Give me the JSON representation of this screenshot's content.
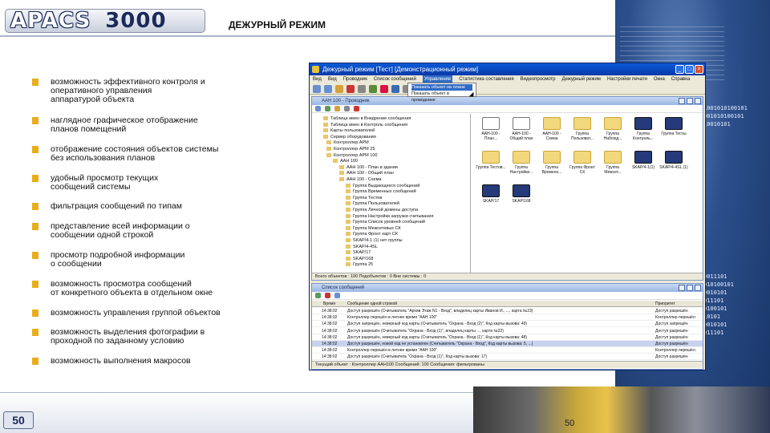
{
  "header": {
    "logo_main": "APACS",
    "logo_num": "3000",
    "title": "ДЕЖУРНЫЙ РЕЖИМ"
  },
  "bullets": [
    "возможность  эффективного контроля и\nоперативного управления\nаппаратурой объекта",
    "наглядное графическое отображение\nпланов помещений",
    "отображение состояния объектов системы\nбез использования планов",
    "удобный просмотр текущих\nсообщений системы",
    "фильтрация сообщений по типам",
    "представление всей информации о\nсообщении одной строкой",
    "просмотр подробной информации\nо сообщении",
    "возможность просмотра сообщений\nот конкретного объекта в отдельном окне",
    "возможность управления группой объектов",
    "возможность выделения фотографии в\nпроходной по заданному условию",
    "возможность выполнения макросов"
  ],
  "footer": {
    "page_box": "50",
    "page_small": "50"
  },
  "deco": {
    "binary_1": "1001010100101\n001010100101\n10010101",
    "binary_2": "0011101\n010100101\n0010101\n011101\n0100101\n10101\n0010101\n011101"
  },
  "app": {
    "window_title": "Дежурный режим [Тест] [Демонстрационный режим]",
    "menu": [
      "Вид",
      "Вид",
      "Проводник",
      "Список сообщений",
      "Управление",
      "Статистика составления",
      "Видеопросмотр",
      "Дежурный режим",
      "Настройки печати",
      "Окна",
      "Справка"
    ],
    "menu_active_index": 4,
    "dropdown": [
      "Показать объект на плане",
      "Показать объект в проводнике"
    ],
    "explorer_title": "ААН 100 - Проводник",
    "message_title": "Список сообщений",
    "tree": [
      "Таблица имен в Внедрение сообщения",
      "Таблица имен в Контроль сообщения",
      "Карты пользователей",
      "Сервер оборудования",
      "Контроллер АРМ",
      "Контроллер АРМ 25",
      "Контроллер АРМ 100",
      "ААН 100",
      "ААН 100 - План в здании",
      "ААН 100 - Общий план",
      "ААН 100 - Схема",
      "Группа Выдающихся сообщений",
      "Группа Временных сообщений",
      "Группа Тестов",
      "Группа Пользователей",
      "Группа Личной домены доступа",
      "Группа Настройки загрузки считывания",
      "Группа Список уровней сообщений",
      "Группа Межсетевых СК",
      "Группа Фронт карт СК",
      "SKAP/4-1 (1) нет группы",
      "SKAP/4-4SL",
      "SKAP/17",
      "SKAP/168",
      "Группа 25"
    ],
    "explorer_icons": [
      {
        "label": "ААН-100 - План...",
        "kind": "chart"
      },
      {
        "label": "ААН-100 - Общий план",
        "kind": "chart"
      },
      {
        "label": "ААН-100 - Схема",
        "kind": "folder"
      },
      {
        "label": "Группа Пользоват...",
        "kind": "folder"
      },
      {
        "label": "Группа Наблюд...",
        "kind": "folder"
      },
      {
        "label": "Группа Контроль...",
        "kind": "dev"
      },
      {
        "label": "Группа Тесты",
        "kind": "dev"
      },
      {
        "label": "Группа Тестов...",
        "kind": "folder"
      },
      {
        "label": "Группа Настройки...",
        "kind": "folder"
      },
      {
        "label": "Группа Временн...",
        "kind": "folder"
      },
      {
        "label": "Группа Фронт СК",
        "kind": "folder"
      },
      {
        "label": "Группа Межсет...",
        "kind": "folder"
      },
      {
        "label": "SKAP/4-1(1)",
        "kind": "dev"
      },
      {
        "label": "SKAP/4-4SL (1)",
        "kind": "dev"
      },
      {
        "label": "SKAP/17",
        "kind": "dev"
      },
      {
        "label": "SKAP/168",
        "kind": "dev"
      }
    ],
    "explorer_status": "Всего объектов : 100          Подобъектов : 0          Вне системы : 0",
    "messages_columns": [
      "Время",
      "Сообщение одной строкой",
      "Приоритет"
    ],
    "messages": [
      {
        "time": "14:38:02",
        "text": "Доступ разрешён (Считыватель \"Архив Этаж N1 - Вход\", владелец карты Иванов И., ..., карта №23)",
        "priority": "Доступ разрешён"
      },
      {
        "time": "14:38:02",
        "text": "Контроллер перешёл в летнее время \"ААН 100\"",
        "priority": "Контроллер перешёл"
      },
      {
        "time": "14:38:02",
        "text": "Доступ запрещён, неверный код карты (Считыватель \"Охрана - Вход (2)\", Код карты вызова: 49)",
        "priority": "Доступ запрещён"
      },
      {
        "time": "14:38:02",
        "text": "Доступ разрешён (Считыватель \"Охрана - Вход (1)\", владелец карты ..., карта №22)",
        "priority": "Доступ разрешён"
      },
      {
        "time": "14:38:02",
        "text": "Доступ разрешён, неверный код карты (Считыватель \"Охрана - Вход (1)\", Код карты вызова: 48)",
        "priority": "Доступ разрешён"
      },
      {
        "time": "14:38:02",
        "text": "Доступ разрешён, новой код не установлен (Считыватель \"Охрана - Вход\", Код карты вызова: 5, ...)",
        "priority": "Доступ разрешён"
      },
      {
        "time": "14:38:02",
        "text": "Контроллер перешёл в летнее время \"ААН 100\"",
        "priority": "Контроллер перешёл"
      },
      {
        "time": "14:38:02",
        "text": "Доступ разрешён (Считыватель \"Охрана - Вход (1)\", Код карты вызова: 17)",
        "priority": "Доступ разрешён"
      }
    ],
    "messages_status": "Текущий объект : Контроллер ААН100          Сообщений: 100          Сообщения: фильтрованы"
  }
}
